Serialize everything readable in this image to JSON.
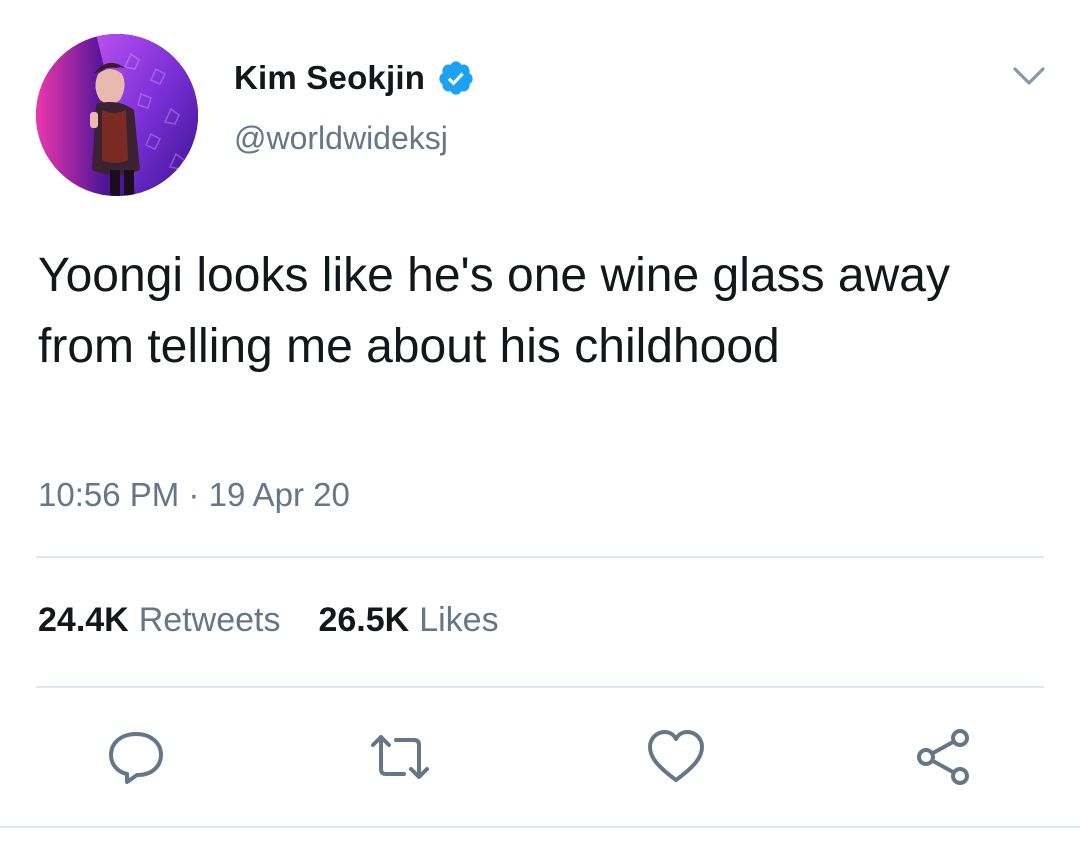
{
  "user": {
    "display_name": "Kim Seokjin",
    "handle": "@worldwideksj",
    "verified_icon": "verified-badge-icon",
    "verified_color": "#1da1f2"
  },
  "tweet": {
    "text": "Yoongi looks like he's one wine glass away from telling me about his childhood",
    "time": "10:56 PM",
    "separator": "·",
    "date": "19 Apr 20"
  },
  "stats": {
    "retweets_count": "24.4K",
    "retweets_label": "Retweets",
    "likes_count": "26.5K",
    "likes_label": "Likes"
  },
  "actions": {
    "reply_icon": "reply-icon",
    "retweet_icon": "retweet-icon",
    "like_icon": "heart-icon",
    "share_icon": "share-icon",
    "menu_icon": "chevron-down-icon"
  },
  "colors": {
    "text": "#14171a",
    "secondary": "#657786",
    "divider": "#e1e8ed",
    "accent": "#1da1f2"
  }
}
